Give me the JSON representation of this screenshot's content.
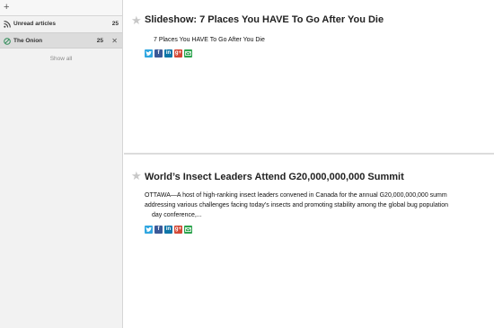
{
  "sidebar": {
    "add_label": "+",
    "feeds": [
      {
        "label": "Unread articles",
        "count": "25",
        "icon": "rss-icon"
      },
      {
        "label": "The Onion",
        "count": "25",
        "icon": "onion-logo-icon",
        "close": "✕"
      }
    ],
    "show_all": "Show all"
  },
  "articles": [
    {
      "title": "Slideshow: 7 Places You HAVE To Go After You Die",
      "summary": "7 Places You HAVE To Go After You Die",
      "share": [
        "twitter-icon",
        "facebook-icon",
        "linkedin-icon",
        "google-plus-icon",
        "email-icon"
      ]
    },
    {
      "title": "World’s Insect Leaders Attend G20,000,000,000 Summit",
      "summary_line1": "OTTAWA—A host of high-ranking insect leaders convened in Canada for the annual G20,000,000,000 summ",
      "summary_line2": "addressing various challenges facing today’s insects and promoting stability among the global bug population",
      "summary_line3": "day conference,...",
      "share": [
        "twitter-icon",
        "facebook-icon",
        "linkedin-icon",
        "google-plus-icon",
        "email-icon"
      ]
    }
  ],
  "colors": {
    "twitter": "#2fa6e0",
    "facebook": "#3b5998",
    "linkedin": "#0e76a8",
    "google_plus": "#d34836",
    "email": "#2da44e",
    "sidebar_bg": "#f2f2f2",
    "selected_feed_bg": "#dcdcdc"
  }
}
